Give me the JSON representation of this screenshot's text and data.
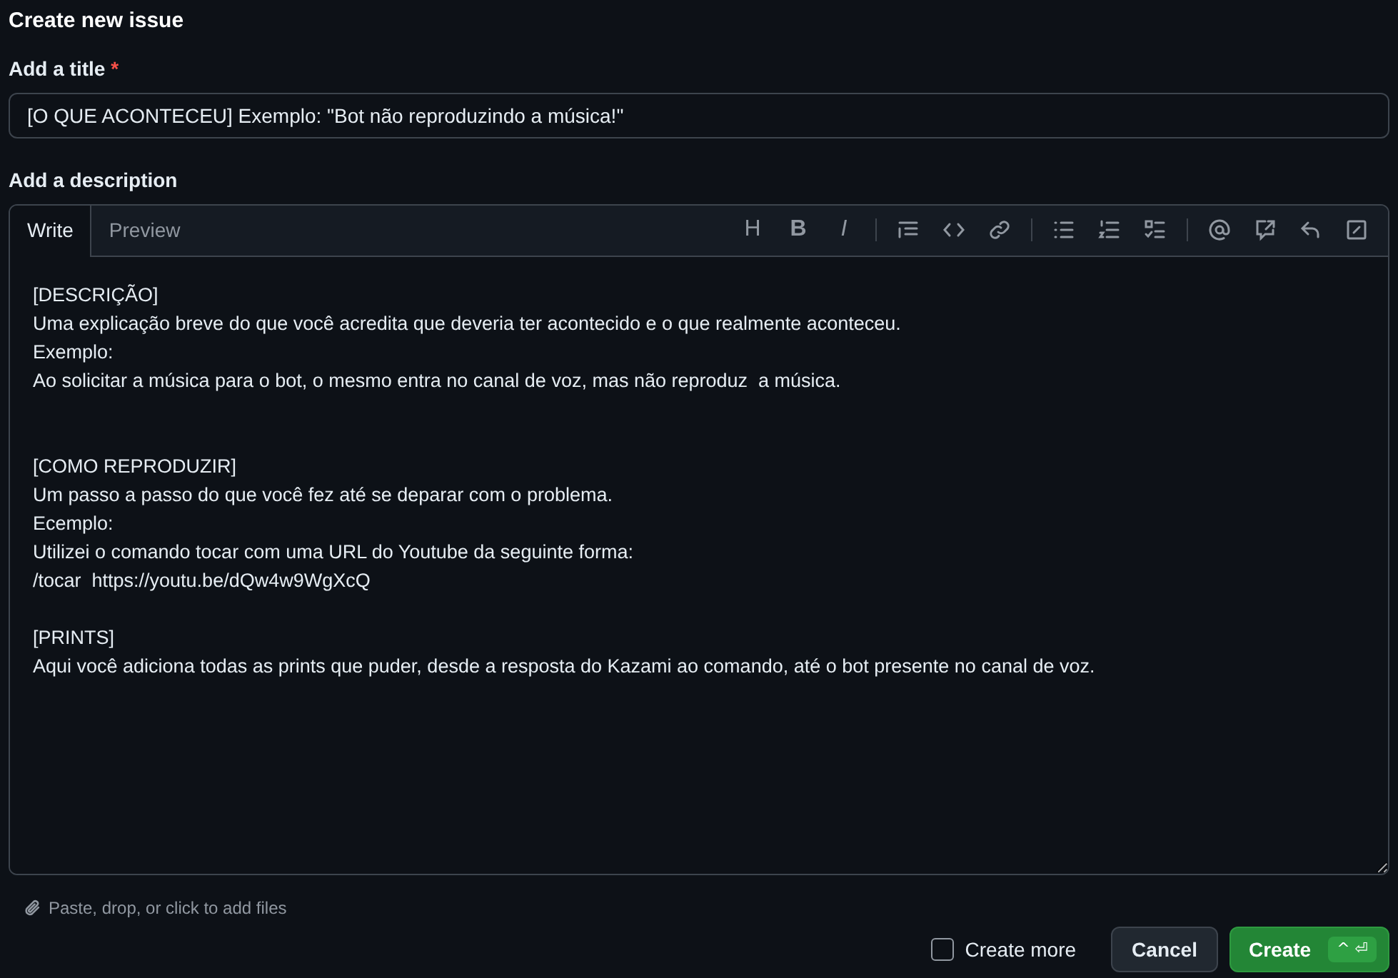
{
  "dialog": {
    "title": "Create new issue"
  },
  "title_field": {
    "label": "Add a title",
    "required_mark": "*",
    "value": "[O QUE ACONTECEU] Exemplo: \"Bot não reproduzindo a música!\""
  },
  "description": {
    "label": "Add a description",
    "tabs": [
      {
        "label": "Write",
        "selected": true
      },
      {
        "label": "Preview",
        "selected": false
      }
    ],
    "toolbar": [
      {
        "kind": "heading",
        "glyph": "H"
      },
      {
        "kind": "bold",
        "glyph": "B"
      },
      {
        "kind": "italic",
        "glyph": "I"
      },
      {
        "kind": "sep"
      },
      {
        "kind": "quote"
      },
      {
        "kind": "code"
      },
      {
        "kind": "link"
      },
      {
        "kind": "sep"
      },
      {
        "kind": "ul"
      },
      {
        "kind": "ol"
      },
      {
        "kind": "tasks"
      },
      {
        "kind": "sep"
      },
      {
        "kind": "mention"
      },
      {
        "kind": "reference"
      },
      {
        "kind": "reply"
      },
      {
        "kind": "fullscreen"
      }
    ],
    "body": "[DESCRIÇÃO]\nUma explicação breve do que você acredita que deveria ter acontecido e o que realmente aconteceu.\nExemplo:\nAo solicitar a música para o bot, o mesmo entra no canal de voz, mas não reproduz  a música.\n\n\n[COMO REPRODUZIR]\nUm passo a passo do que você fez até se deparar com o problema.\nEcemplo:\nUtilizei o comando tocar com uma URL do Youtube da seguinte forma:\n/tocar  https://youtu.be/dQw4w9WgXcQ\n\n[PRINTS]\nAqui você adiciona todas as prints que puder, desde a resposta do Kazami ao comando, até o bot presente no canal de voz.",
    "attach_hint": "Paste, drop, or click to add files"
  },
  "footer": {
    "create_more": {
      "label": "Create more",
      "checked": false
    },
    "cancel": "Cancel",
    "create": "Create",
    "shortcut": "^ ⏎"
  }
}
